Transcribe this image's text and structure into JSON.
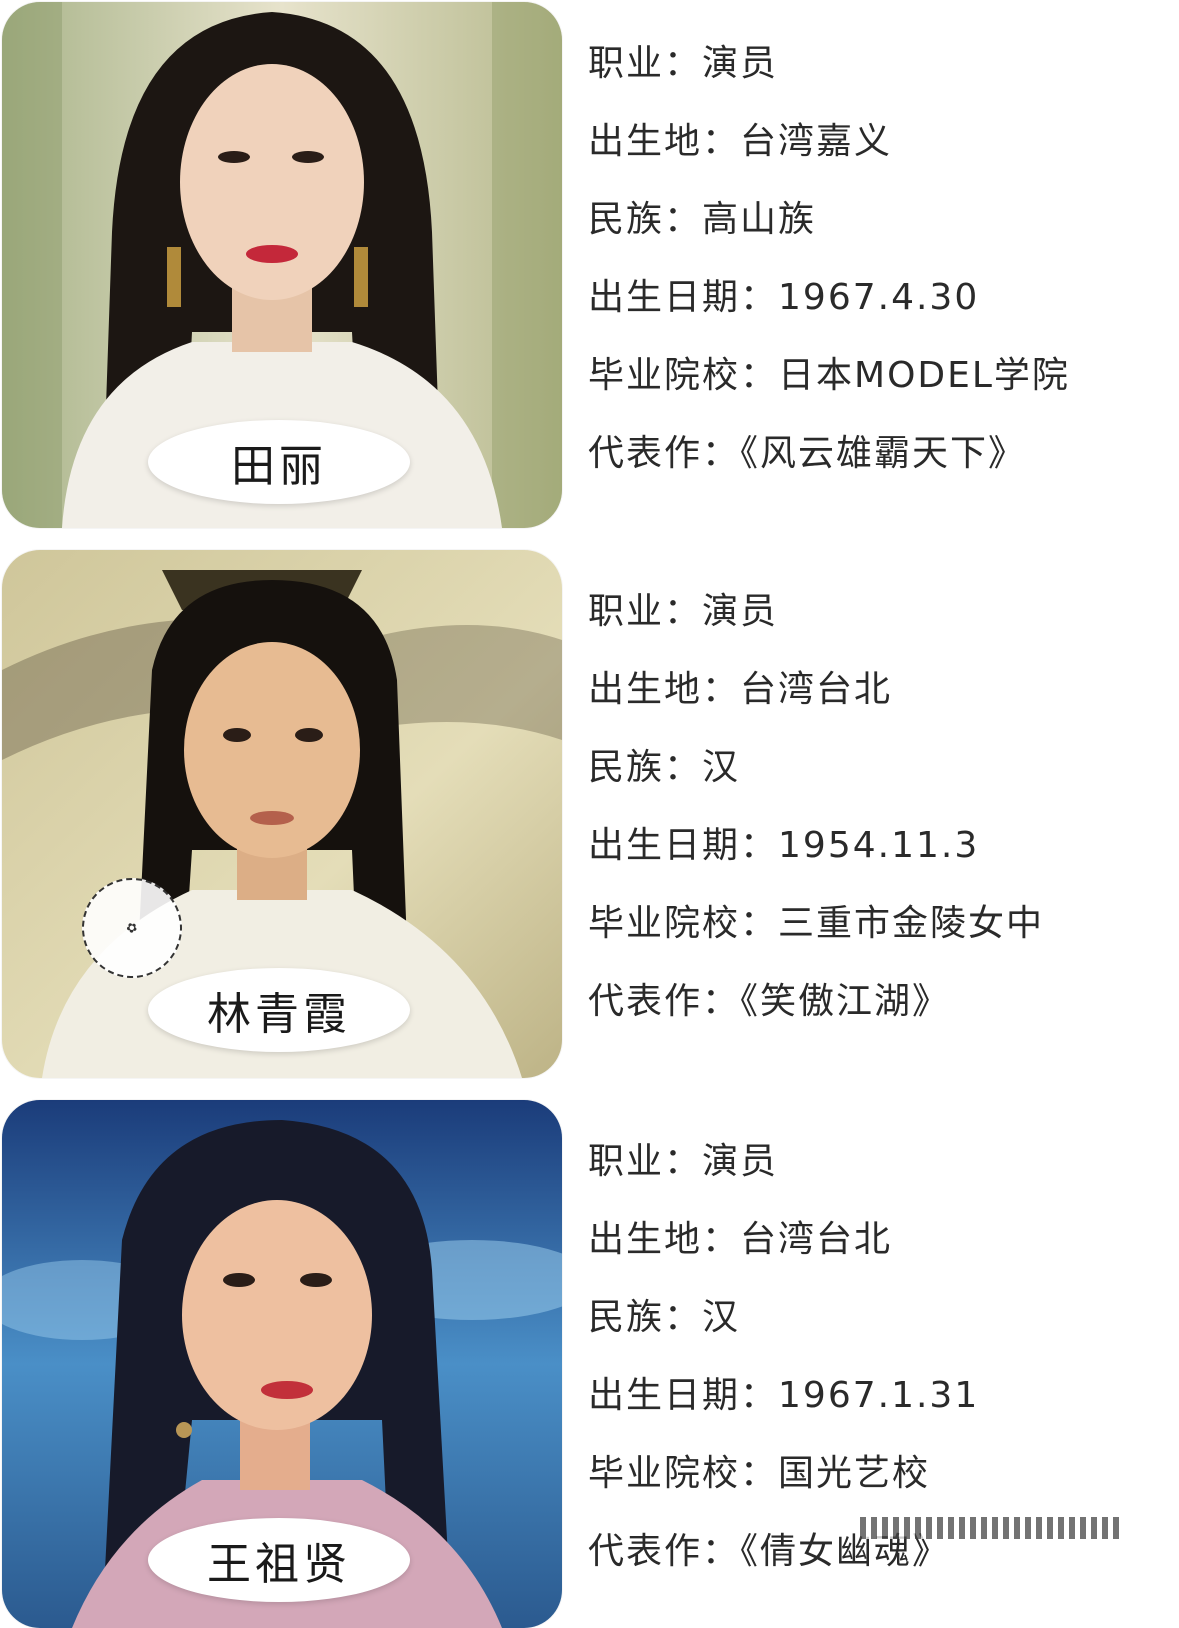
{
  "cards": [
    {
      "name": "田丽",
      "fields": [
        {
          "label": "职业：",
          "value": "演员"
        },
        {
          "label": "出生地：",
          "value": "台湾嘉义"
        },
        {
          "label": "民族：",
          "value": "高山族"
        },
        {
          "label": "出生日期：",
          "value": "1967.4.30"
        },
        {
          "label": "毕业院校：",
          "value": "日本MODEL学院"
        },
        {
          "label": "代表作：",
          "value": "《风云雄霸天下》"
        }
      ]
    },
    {
      "name": "林青霞",
      "fields": [
        {
          "label": "职业：",
          "value": "演员"
        },
        {
          "label": "出生地：",
          "value": "台湾台北"
        },
        {
          "label": "民族：",
          "value": "汉"
        },
        {
          "label": "出生日期：",
          "value": "1954.11.3"
        },
        {
          "label": "毕业院校：",
          "value": "三重市金陵女中"
        },
        {
          "label": "代表作：",
          "value": "《笑傲江湖》"
        }
      ]
    },
    {
      "name": "王祖贤",
      "fields": [
        {
          "label": "职业：",
          "value": "演员"
        },
        {
          "label": "出生地：",
          "value": "台湾台北"
        },
        {
          "label": "民族：",
          "value": "汉"
        },
        {
          "label": "出生日期：",
          "value": "1967.1.31"
        },
        {
          "label": "毕业院校：",
          "value": "国光艺校"
        },
        {
          "label": "代表作：",
          "value": "《倩女幽魂》"
        }
      ]
    }
  ]
}
